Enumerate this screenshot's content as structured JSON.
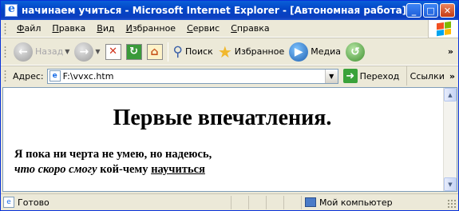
{
  "window": {
    "title": "начинаем учиться - Microsoft Internet Explorer - [Автономная работа]",
    "buttons": {
      "minimize": "_",
      "maximize": "□",
      "close": "✕"
    }
  },
  "menu": {
    "items": [
      {
        "first": "Ф",
        "rest": "айл"
      },
      {
        "first": "П",
        "rest": "равка"
      },
      {
        "first": "В",
        "rest": "ид"
      },
      {
        "first": "И",
        "rest": "збранное"
      },
      {
        "first": "С",
        "rest": "ервис"
      },
      {
        "first": "С",
        "rest": "правка"
      }
    ]
  },
  "toolbar": {
    "back_label": "Назад",
    "search_label": "Поиск",
    "favorites_label": "Избранное",
    "media_label": "Медиа",
    "more": "»"
  },
  "address": {
    "label": "Адрес:",
    "value": "F:\\vvxc.htm",
    "go_label": "Переход",
    "links_label": "Ссылки",
    "links_more": "»"
  },
  "document": {
    "heading": "Первые впечатления.",
    "line1": "Я пока ни черта не умею, но надеюсь,",
    "line2_italic": "что скоро смогу",
    "line2_plain": " кой-чему ",
    "line2_underlined": "научиться"
  },
  "status": {
    "text": "Готово",
    "zone": "Мой компьютер"
  },
  "colors": {
    "title_bar": "#0244c6",
    "chrome": "#ece9d8",
    "content_bg": "#ffffff"
  }
}
